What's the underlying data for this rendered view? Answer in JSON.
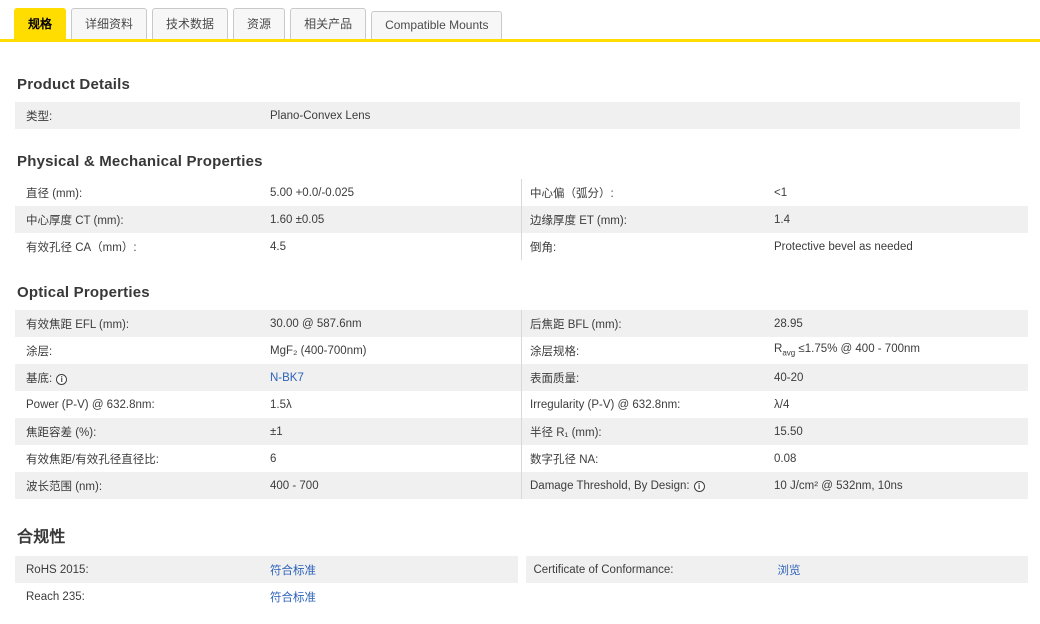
{
  "colors": {
    "accent_yellow": "#ffdd00",
    "link_blue": "#2c62b8",
    "row_shade": "#f0f0f0"
  },
  "tabs": [
    {
      "id": "specs",
      "label": "规格",
      "active": true
    },
    {
      "id": "details",
      "label": "详细资料",
      "active": false
    },
    {
      "id": "tech-data",
      "label": "技术数据",
      "active": false
    },
    {
      "id": "resources",
      "label": "资源",
      "active": false
    },
    {
      "id": "related-products",
      "label": "相关产品",
      "active": false
    },
    {
      "id": "compatible-mounts",
      "label": "Compatible Mounts",
      "active": false
    }
  ],
  "sections": [
    {
      "id": "product-details",
      "title": "Product Details",
      "title_cjk": false,
      "two_col": false,
      "divider": false,
      "tables": [
        {
          "side": "left",
          "rows": [
            {
              "label": "类型:",
              "value": "Plano-Convex Lens",
              "shaded": true
            }
          ]
        }
      ]
    },
    {
      "id": "physical-mechanical",
      "title": "Physical & Mechanical Properties",
      "title_cjk": false,
      "two_col": true,
      "divider": true,
      "tables": [
        {
          "side": "left",
          "rows": [
            {
              "label": "直径 (mm):",
              "value": "5.00 +0.0/-0.025",
              "shaded": false
            },
            {
              "label": "中心厚度 CT (mm):",
              "value": "1.60 ±0.05",
              "shaded": true
            },
            {
              "label": "有效孔径 CA（mm）:",
              "value": "4.5",
              "shaded": false
            }
          ]
        },
        {
          "side": "right",
          "rows": [
            {
              "label": "中心偏（弧分）:",
              "value": "<1",
              "shaded": false
            },
            {
              "label": "边缘厚度 ET (mm):",
              "value": "1.4",
              "shaded": true
            },
            {
              "label": "倒角:",
              "value": "Protective bevel as needed",
              "shaded": false
            }
          ]
        }
      ]
    },
    {
      "id": "optical-properties",
      "title": "Optical Properties",
      "title_cjk": false,
      "two_col": true,
      "divider": true,
      "tables": [
        {
          "side": "left",
          "rows": [
            {
              "label": "有效焦距 EFL (mm):",
              "value": "30.00 @ 587.6nm",
              "shaded": true
            },
            {
              "label": "涂层:",
              "value": "MgF₂ (400-700nm)",
              "shaded": false
            },
            {
              "label": "基底:",
              "value": "N-BK7",
              "link": true,
              "info": true,
              "shaded": true
            },
            {
              "label": "Power (P-V) @ 632.8nm:",
              "value": "1.5λ",
              "shaded": false
            },
            {
              "label": "焦距容差 (%):",
              "value": "±1",
              "shaded": true
            },
            {
              "label": "有效焦距/有效孔径直径比:",
              "value": "6",
              "shaded": false
            },
            {
              "label": "波长范围 (nm):",
              "value": "400 - 700",
              "shaded": true
            }
          ]
        },
        {
          "side": "right",
          "rows": [
            {
              "label": "后焦距 BFL (mm):",
              "value": "28.95",
              "shaded": true
            },
            {
              "label": "涂层规格:",
              "value": "Ravg ≤1.75% @ 400 - 700nm",
              "value_html": "R<sub>avg</sub> ≤1.75% @ 400 - 700nm",
              "shaded": false
            },
            {
              "label": "表面质量:",
              "value": "40-20",
              "shaded": true
            },
            {
              "label": "Irregularity (P-V) @ 632.8nm:",
              "value": "λ/4",
              "shaded": false
            },
            {
              "label": "半径 R₁ (mm):",
              "value": "15.50",
              "shaded": true
            },
            {
              "label": "数字孔径 NA:",
              "value": "0.08",
              "shaded": false
            },
            {
              "label": "Damage Threshold, By Design:",
              "value": "10 J/cm² @ 532nm, 10ns",
              "info": true,
              "shaded": true
            }
          ]
        }
      ]
    },
    {
      "id": "compliance",
      "title": "合规性",
      "title_cjk": true,
      "two_col": true,
      "divider": false,
      "tables": [
        {
          "side": "left",
          "rows": [
            {
              "label": "RoHS 2015:",
              "value": "符合标准",
              "link": true,
              "shaded": true
            },
            {
              "label": "Reach 235:",
              "value": "符合标准",
              "link": true,
              "shaded": false
            }
          ]
        },
        {
          "side": "right",
          "rows": [
            {
              "label": "Certificate of Conformance:",
              "value": "浏览",
              "link": true,
              "shaded": true
            }
          ]
        }
      ]
    }
  ]
}
